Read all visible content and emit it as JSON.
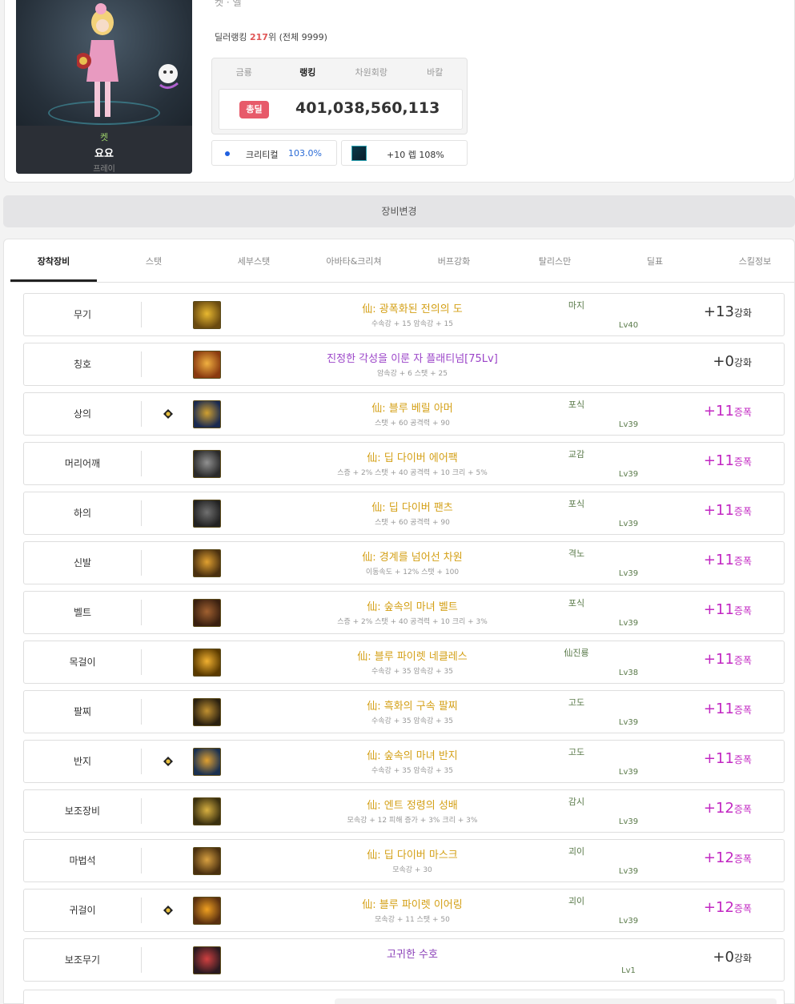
{
  "header": {
    "top_cut_text": "켓 · 엘",
    "rank_prefix": "딜러랭킹",
    "rank_value": "217",
    "rank_suffix": "위 (전체 9999)"
  },
  "character": {
    "server": "켓",
    "name": "요요",
    "class": "프레이"
  },
  "stats": {
    "tabs": [
      "금룡",
      "랭킹",
      "차원회랑",
      "바칼"
    ],
    "active_tab": "랭킹",
    "badge": "총딜",
    "value": "401,038,560,113",
    "crit_label": "크리티컬",
    "crit_value": "103.0%",
    "buff_text": "+10 렙 108%"
  },
  "change_button": "장비변경",
  "tabs": [
    {
      "label": "장착장비",
      "active": true
    },
    {
      "label": "스탯",
      "active": false
    },
    {
      "label": "세부스탯",
      "active": false
    },
    {
      "label": "아바타&크리쳐",
      "active": false
    },
    {
      "label": "버프강화",
      "active": false
    },
    {
      "label": "탈리스만",
      "active": false
    },
    {
      "label": "딜표",
      "active": false
    },
    {
      "label": "스킬정보",
      "active": false
    }
  ],
  "colors": {
    "gold": "#d4a017",
    "purple": "#9b44c8",
    "magenta": "#c227c2",
    "badge_red": "#e75a6a",
    "crit_blue": "#2a6bd6"
  },
  "equipment": [
    {
      "slot": "무기",
      "mark": false,
      "icon": "weapon-icon",
      "name": "仙: 광폭화된 전의의 도",
      "name_color": "gold",
      "sub": "수속강 + 15 암속강 + 15",
      "tag": "마지",
      "lv": "Lv40",
      "enh_num": "+13",
      "enh_unit": "강화",
      "enh_color": "dark"
    },
    {
      "slot": "칭호",
      "mark": false,
      "icon": "title-icon",
      "name": "진정한 각성을 이룬 자 플래티넘[75Lv]",
      "name_color": "purple",
      "sub": "암속강 + 6 스탯 + 25",
      "tag": "",
      "lv": "",
      "enh_num": "+0",
      "enh_unit": "강화",
      "enh_color": "dark"
    },
    {
      "slot": "상의",
      "mark": true,
      "icon": "top-armor-icon",
      "name": "仙: 블루 베릴 아머",
      "name_color": "gold",
      "sub": "스탯 + 60 공격력 + 90",
      "tag": "포식",
      "lv": "Lv39",
      "enh_num": "+11",
      "enh_unit": "증폭",
      "enh_color": "magenta"
    },
    {
      "slot": "머리어깨",
      "mark": false,
      "icon": "shoulder-icon",
      "name": "仙: 딥 다이버 에어팩",
      "name_color": "gold",
      "sub": "스증 + 2% 스탯 + 40 공격력 + 10 크리 + 5%",
      "tag": "교감",
      "lv": "Lv39",
      "enh_num": "+11",
      "enh_unit": "증폭",
      "enh_color": "magenta"
    },
    {
      "slot": "하의",
      "mark": false,
      "icon": "pants-icon",
      "name": "仙: 딥 다이버 팬츠",
      "name_color": "gold",
      "sub": "스탯 + 60 공격력 + 90",
      "tag": "포식",
      "lv": "Lv39",
      "enh_num": "+11",
      "enh_unit": "증폭",
      "enh_color": "magenta"
    },
    {
      "slot": "신발",
      "mark": false,
      "icon": "shoes-icon",
      "name": "仙: 경계를 넘어선 차원",
      "name_color": "gold",
      "sub": "이동속도 + 12% 스탯 + 100",
      "tag": "격노",
      "lv": "Lv39",
      "enh_num": "+11",
      "enh_unit": "증폭",
      "enh_color": "magenta"
    },
    {
      "slot": "벨트",
      "mark": false,
      "icon": "belt-icon",
      "name": "仙: 숲속의 마녀 벨트",
      "name_color": "gold",
      "sub": "스증 + 2% 스탯 + 40 공격력 + 10 크리 + 3%",
      "tag": "포식",
      "lv": "Lv39",
      "enh_num": "+11",
      "enh_unit": "증폭",
      "enh_color": "magenta"
    },
    {
      "slot": "목걸이",
      "mark": false,
      "icon": "necklace-icon",
      "name": "仙: 블루 파이렛 네클레스",
      "name_color": "gold",
      "sub": "수속강 + 35 암속강 + 35",
      "tag": "仙진룡",
      "lv": "Lv38",
      "enh_num": "+11",
      "enh_unit": "증폭",
      "enh_color": "magenta"
    },
    {
      "slot": "팔찌",
      "mark": false,
      "icon": "bracelet-icon",
      "name": "仙: 흑화의 구속 팔찌",
      "name_color": "gold",
      "sub": "수속강 + 35 암속강 + 35",
      "tag": "고도",
      "lv": "Lv39",
      "enh_num": "+11",
      "enh_unit": "증폭",
      "enh_color": "magenta"
    },
    {
      "slot": "반지",
      "mark": true,
      "icon": "ring-icon",
      "name": "仙: 숲속의 마녀 반지",
      "name_color": "gold",
      "sub": "수속강 + 35 암속강 + 35",
      "tag": "고도",
      "lv": "Lv39",
      "enh_num": "+11",
      "enh_unit": "증폭",
      "enh_color": "magenta"
    },
    {
      "slot": "보조장비",
      "mark": false,
      "icon": "sub-equipment-icon",
      "name": "仙: 엔트 정령의 성배",
      "name_color": "gold",
      "sub": "모속강 + 12 피해 증가 + 3% 크리 + 3%",
      "tag": "감시",
      "lv": "Lv39",
      "enh_num": "+12",
      "enh_unit": "증폭",
      "enh_color": "magenta"
    },
    {
      "slot": "마법석",
      "mark": false,
      "icon": "magic-stone-icon",
      "name": "仙: 딥 다이버 마스크",
      "name_color": "gold",
      "sub": "모속강 + 30",
      "tag": "괴이",
      "lv": "Lv39",
      "enh_num": "+12",
      "enh_unit": "증폭",
      "enh_color": "magenta"
    },
    {
      "slot": "귀걸이",
      "mark": true,
      "icon": "earring-icon",
      "name": "仙: 블루 파이렛 이어링",
      "name_color": "gold",
      "sub": "모속강 + 11 스탯 + 50",
      "tag": "괴이",
      "lv": "Lv39",
      "enh_num": "+12",
      "enh_unit": "증폭",
      "enh_color": "magenta"
    },
    {
      "slot": "보조무기",
      "mark": false,
      "icon": "sub-weapon-icon",
      "name": "고귀한 수호",
      "name_color": "violet",
      "sub": "",
      "tag": "",
      "lv": "Lv1",
      "enh_num": "+0",
      "enh_unit": "강화",
      "enh_color": "dark"
    }
  ]
}
